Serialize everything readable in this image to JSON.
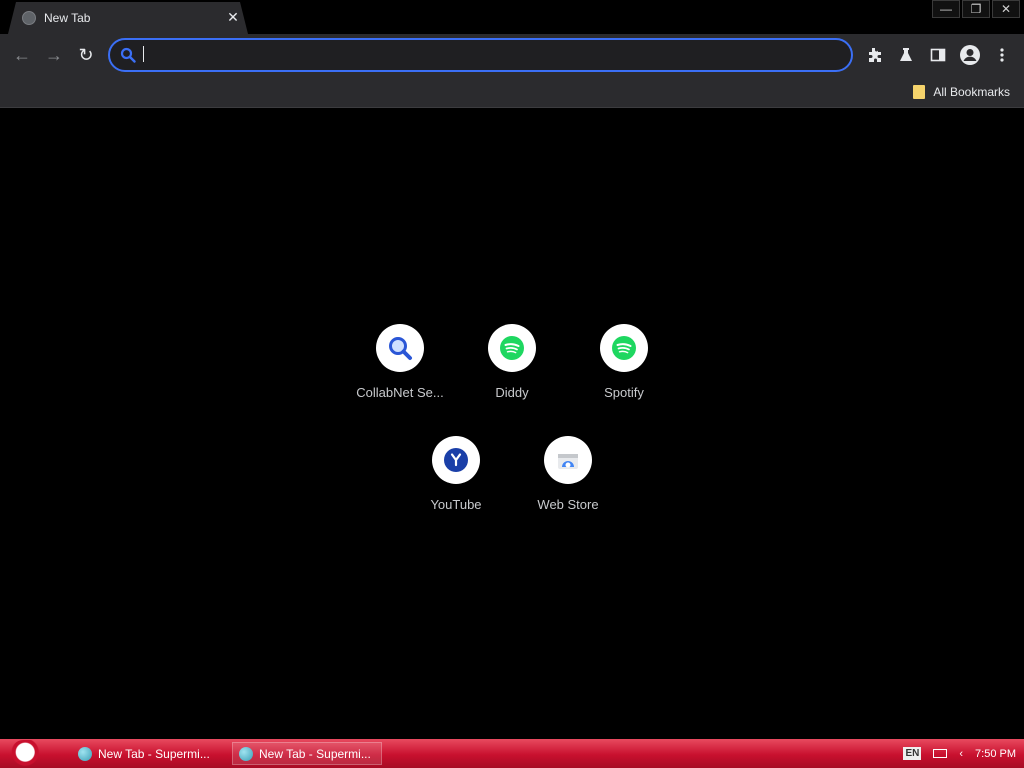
{
  "tab": {
    "title": "New Tab",
    "close_glyph": "✕"
  },
  "window_controls": {
    "minimize": "—",
    "restore": "❐",
    "close": "✕"
  },
  "toolbar": {
    "back_glyph": "←",
    "forward_glyph": "→",
    "reload_glyph": "↻",
    "omnibox_value": "",
    "icons": [
      "extensions-icon",
      "labs-icon",
      "side-panel-icon",
      "profile-icon",
      "menu-icon"
    ]
  },
  "bookmarks": {
    "all_bookmarks_label": "All Bookmarks"
  },
  "shortcuts": [
    {
      "label": "CollabNet Se...",
      "icon": "magnifier-icon"
    },
    {
      "label": "Diddy",
      "icon": "spotify-icon"
    },
    {
      "label": "Spotify",
      "icon": "spotify-icon"
    },
    {
      "label": "YouTube",
      "icon": "youtube-y-icon"
    },
    {
      "label": "Web Store",
      "icon": "web-store-icon"
    }
  ],
  "taskbar": {
    "items": [
      {
        "label": "New Tab - Supermi..."
      },
      {
        "label": "New Tab - Supermi..."
      }
    ],
    "tray": {
      "language": "EN",
      "time": "7:50 PM"
    }
  },
  "colors": {
    "accent": "#3b6ff5",
    "spotify": "#1ed760",
    "taskbar": "#c8102e"
  }
}
